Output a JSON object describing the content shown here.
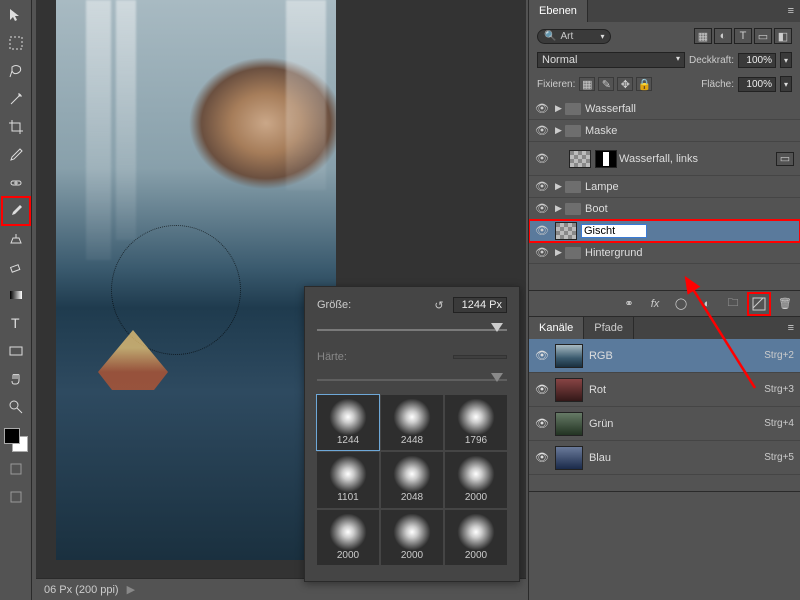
{
  "toolbar": {
    "tools": [
      {
        "name": "move-tool"
      },
      {
        "name": "marquee-tool"
      },
      {
        "name": "lasso-tool"
      },
      {
        "name": "magic-wand-tool"
      },
      {
        "name": "crop-tool"
      },
      {
        "name": "eyedropper-tool"
      },
      {
        "name": "healing-brush-tool"
      },
      {
        "name": "brush-tool",
        "selected": true
      },
      {
        "name": "clone-stamp-tool"
      },
      {
        "name": "eraser-tool"
      },
      {
        "name": "gradient-tool"
      },
      {
        "name": "type-tool"
      },
      {
        "name": "rectangle-tool"
      },
      {
        "name": "hand-tool"
      },
      {
        "name": "zoom-tool"
      }
    ]
  },
  "canvas": {
    "zoom_status": "06 Px (200 ppi)"
  },
  "brush_panel": {
    "size_label": "Größe:",
    "size_value": "1244 Px",
    "hardness_label": "Härte:",
    "hardness_value": "",
    "brushes": [
      {
        "n": "1244",
        "sel": true
      },
      {
        "n": "2448"
      },
      {
        "n": "1796"
      },
      {
        "n": "1101"
      },
      {
        "n": "2048"
      },
      {
        "n": "2000"
      },
      {
        "n": "2000"
      },
      {
        "n": "2000"
      },
      {
        "n": "2000"
      }
    ]
  },
  "layers_panel": {
    "tab_layers": "Ebenen",
    "filter_value": "Art",
    "blend_mode": "Normal",
    "opacity_label": "Deckkraft:",
    "opacity_value": "100%",
    "lock_label": "Fixieren:",
    "fill_label": "Fläche:",
    "fill_value": "100%",
    "layers": [
      {
        "type": "group",
        "name": "Wasserfall",
        "indent": 0
      },
      {
        "type": "group",
        "name": "Maske",
        "indent": 0
      },
      {
        "type": "masked",
        "name": "Wasserfall, links",
        "indent": 1,
        "link": true
      },
      {
        "type": "group",
        "name": "Lampe",
        "indent": 0
      },
      {
        "type": "group",
        "name": "Boot",
        "indent": 0
      },
      {
        "type": "layer",
        "name": "Gischt",
        "indent": 0,
        "rename": true,
        "highlight": true
      },
      {
        "type": "group",
        "name": "Hintergrund",
        "indent": 0
      }
    ]
  },
  "channels_panel": {
    "tab_channels": "Kanäle",
    "tab_paths": "Pfade",
    "channels": [
      {
        "name": "RGB",
        "shortcut": "Strg+2",
        "sel": true,
        "cls": ""
      },
      {
        "name": "Rot",
        "shortcut": "Strg+3",
        "cls": "ch-red"
      },
      {
        "name": "Grün",
        "shortcut": "Strg+4",
        "cls": "ch-green"
      },
      {
        "name": "Blau",
        "shortcut": "Strg+5",
        "cls": "ch-blue"
      }
    ]
  }
}
